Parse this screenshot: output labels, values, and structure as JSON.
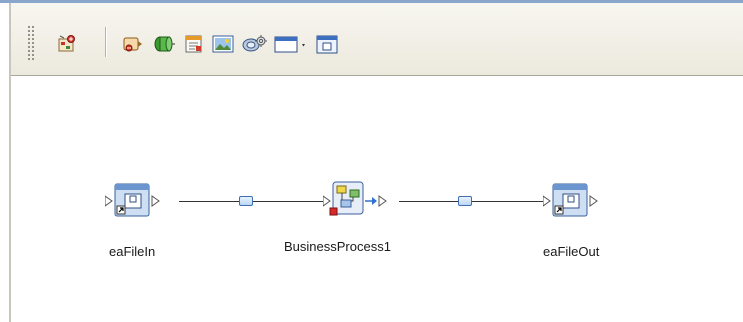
{
  "toolbar": {
    "buttons": [
      {
        "name": "map-components-icon",
        "title": ""
      },
      {
        "name": "add-service-icon",
        "title": ""
      },
      {
        "name": "add-adapter-icon",
        "title": ""
      },
      {
        "name": "add-form-icon",
        "title": ""
      },
      {
        "name": "add-image-icon",
        "title": ""
      },
      {
        "name": "add-process-icon",
        "title": ""
      },
      {
        "name": "window-dropdown-icon",
        "title": ""
      },
      {
        "name": "external-application-icon",
        "title": ""
      }
    ]
  },
  "canvas": {
    "components": [
      {
        "id": "eaFileIn",
        "label": "eaFileIn",
        "type": "external-application"
      },
      {
        "id": "BusinessProcess1",
        "label": "BusinessProcess1",
        "type": "business-process"
      },
      {
        "id": "eaFileOut",
        "label": "eaFileOut",
        "type": "external-application"
      }
    ],
    "links": [
      {
        "from": "eaFileIn",
        "to": "BusinessProcess1"
      },
      {
        "from": "BusinessProcess1",
        "to": "eaFileOut"
      }
    ]
  },
  "colors": {
    "toolbar_bg": "#ece9dd",
    "window_border": "#8aa6cc",
    "link_node": "#3f6fb0",
    "connector": "#333333"
  }
}
